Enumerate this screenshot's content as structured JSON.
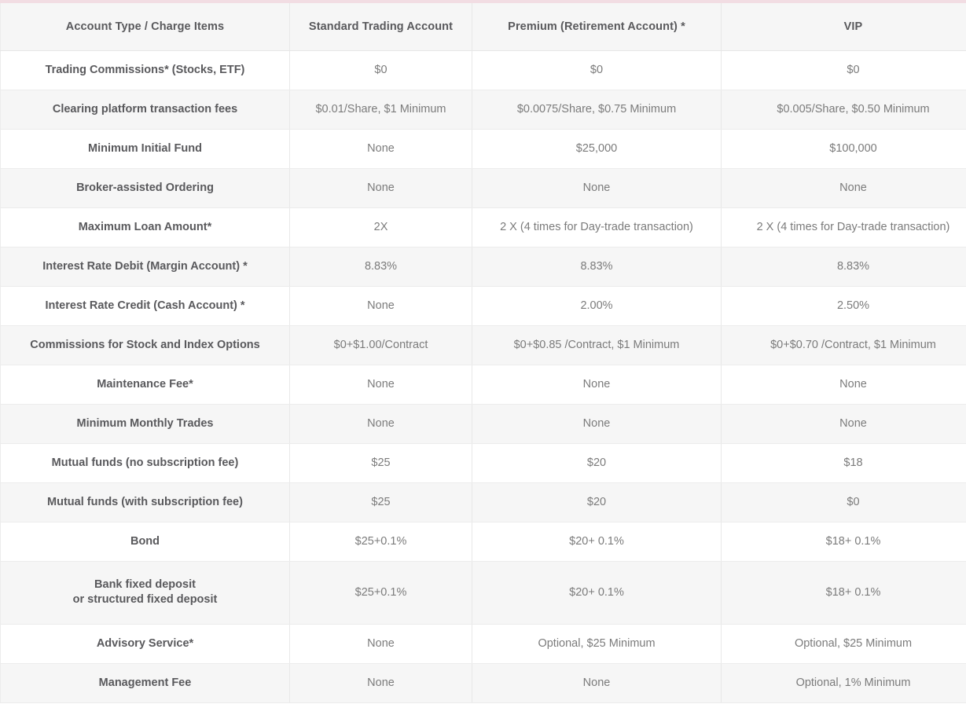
{
  "table": {
    "columns": [
      "Account Type / Charge Items",
      "Standard Trading Account",
      "Premium (Retirement Account) *",
      "VIP"
    ],
    "rows": [
      {
        "item": "Trading Commissions* (Stocks, ETF)",
        "item_line2": "",
        "standard": "$0",
        "premium": "$0",
        "vip": "$0"
      },
      {
        "item": "Clearing platform transaction fees",
        "item_line2": "",
        "standard": "$0.01/Share, $1 Minimum",
        "premium": "$0.0075/Share, $0.75 Minimum",
        "vip": "$0.005/Share, $0.50 Minimum"
      },
      {
        "item": "Minimum Initial Fund",
        "item_line2": "",
        "standard": "None",
        "premium": "$25,000",
        "vip": "$100,000"
      },
      {
        "item": "Broker-assisted Ordering",
        "item_line2": "",
        "standard": "None",
        "premium": "None",
        "vip": "None"
      },
      {
        "item": "Maximum Loan Amount*",
        "item_line2": "",
        "standard": "2X",
        "premium": "2 X (4 times for Day-trade transaction)",
        "vip": "2 X (4 times for Day-trade transaction)"
      },
      {
        "item": "Interest Rate Debit (Margin Account) *",
        "item_line2": "",
        "standard": "8.83%",
        "premium": "8.83%",
        "vip": "8.83%"
      },
      {
        "item": "Interest Rate Credit (Cash Account) *",
        "item_line2": "",
        "standard": "None",
        "premium": "2.00%",
        "vip": "2.50%"
      },
      {
        "item": "Commissions for Stock and Index Options",
        "item_line2": "",
        "standard": "$0+$1.00/Contract",
        "premium": "$0+$0.85 /Contract, $1 Minimum",
        "vip": "$0+$0.70 /Contract, $1 Minimum"
      },
      {
        "item": "Maintenance Fee*",
        "item_line2": "",
        "standard": "None",
        "premium": "None",
        "vip": "None"
      },
      {
        "item": "Minimum Monthly Trades",
        "item_line2": "",
        "standard": "None",
        "premium": "None",
        "vip": "None"
      },
      {
        "item": "Mutual funds (no subscription fee)",
        "item_line2": "",
        "standard": "$25",
        "premium": "$20",
        "vip": "$18"
      },
      {
        "item": "Mutual funds (with subscription fee)",
        "item_line2": "",
        "standard": "$25",
        "premium": "$20",
        "vip": "$0"
      },
      {
        "item": "Bond",
        "item_line2": "",
        "standard": "$25+0.1%",
        "premium": "$20+ 0.1%",
        "vip": "$18+ 0.1%"
      },
      {
        "item": "Bank fixed deposit",
        "item_line2": "or structured fixed deposit",
        "standard": "$25+0.1%",
        "premium": "$20+ 0.1%",
        "vip": "$18+ 0.1%"
      },
      {
        "item": "Advisory Service*",
        "item_line2": "",
        "standard": "None",
        "premium": "Optional, $25 Minimum",
        "vip": "Optional, $25 Minimum"
      },
      {
        "item": "Management Fee",
        "item_line2": "",
        "standard": "None",
        "premium": "None",
        "vip": "Optional, 1% Minimum"
      }
    ]
  },
  "colors": {
    "top_border": "#f2dde3",
    "header_bg": "#f6f6f6",
    "stripe_bg": "#f6f6f6",
    "row_bg": "#ffffff",
    "header_text": "#59595c",
    "item_text": "#59595c",
    "value_text": "#7b7b7b",
    "grid_line": "#e8e8e8"
  }
}
